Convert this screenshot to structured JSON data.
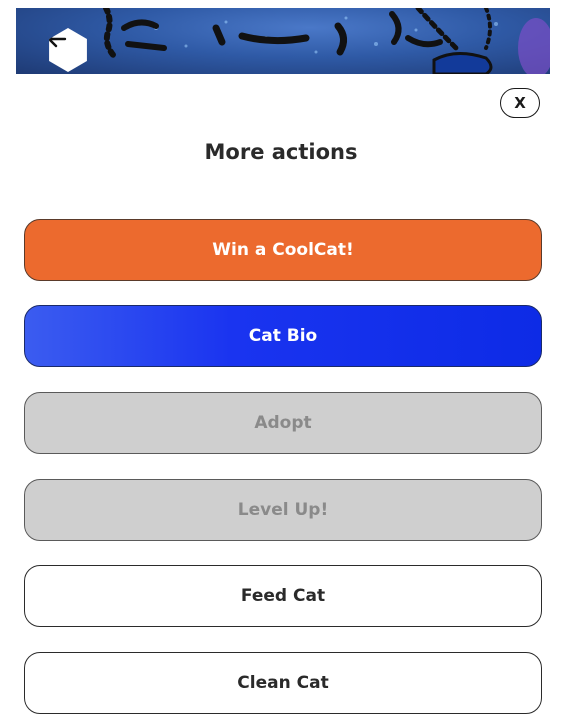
{
  "header": {
    "back_icon": "arrow-left-icon"
  },
  "dialog": {
    "close_label": "X",
    "title": "More actions"
  },
  "actions": [
    {
      "label": "Win a CoolCat!",
      "state": "enabled",
      "color": "#ec6a2e"
    },
    {
      "label": "Cat Bio",
      "state": "enabled",
      "color": "#1a34f0"
    },
    {
      "label": "Adopt",
      "state": "disabled",
      "color": "#cfcfcf"
    },
    {
      "label": "Level Up!",
      "state": "disabled",
      "color": "#cfcfcf"
    },
    {
      "label": "Feed Cat",
      "state": "enabled",
      "color": "#ffffff"
    },
    {
      "label": "Clean Cat",
      "state": "enabled",
      "color": "#ffffff"
    }
  ]
}
